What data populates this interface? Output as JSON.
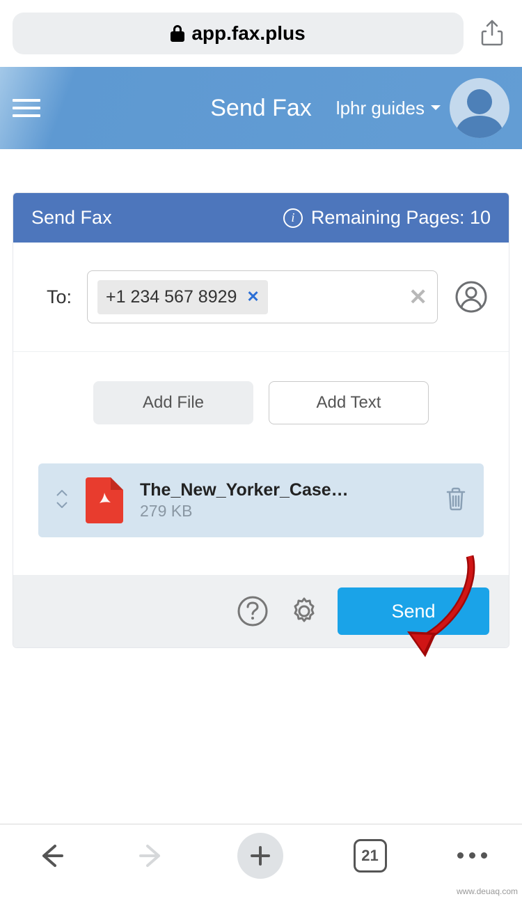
{
  "browser": {
    "url_display": "app.fax.plus",
    "tab_count": "21"
  },
  "header": {
    "page_title": "Send Fax",
    "user_label": "lphr guides"
  },
  "card": {
    "title": "Send Fax",
    "remaining_label": "Remaining Pages: 10"
  },
  "compose": {
    "to_label": "To:",
    "recipient_chip": "+1 234 567 8929",
    "add_file_label": "Add File",
    "add_text_label": "Add Text"
  },
  "attachment": {
    "file_name": "The_New_Yorker_Case…",
    "file_size": "279 KB"
  },
  "actions": {
    "send_label": "Send"
  },
  "watermark": "www.deuaq.com"
}
